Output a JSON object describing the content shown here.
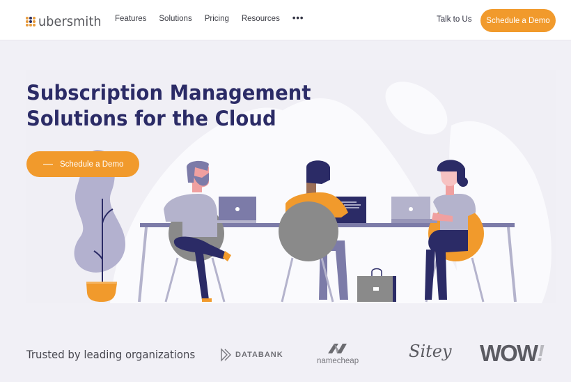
{
  "header": {
    "logo_text": "ubersmith",
    "nav": [
      {
        "label": "Features"
      },
      {
        "label": "Solutions"
      },
      {
        "label": "Pricing"
      },
      {
        "label": "Resources"
      }
    ],
    "more_label": "•••",
    "talk_label": "Talk to Us",
    "cta_label": "Schedule a Demo"
  },
  "hero": {
    "title_line1": "Subscription Management",
    "title_line2": "Solutions for the Cloud",
    "cta_label": "Schedule a Demo"
  },
  "trusted": {
    "label": "Trusted by leading organizations",
    "logos": [
      {
        "name": "DATABANK"
      },
      {
        "name": "namecheap"
      },
      {
        "name": "Sitey"
      },
      {
        "name": "WOW",
        "suffix": "!"
      }
    ]
  },
  "colors": {
    "accent": "#f19a2c",
    "navy": "#2b2b66",
    "background": "#f1f0f6"
  }
}
